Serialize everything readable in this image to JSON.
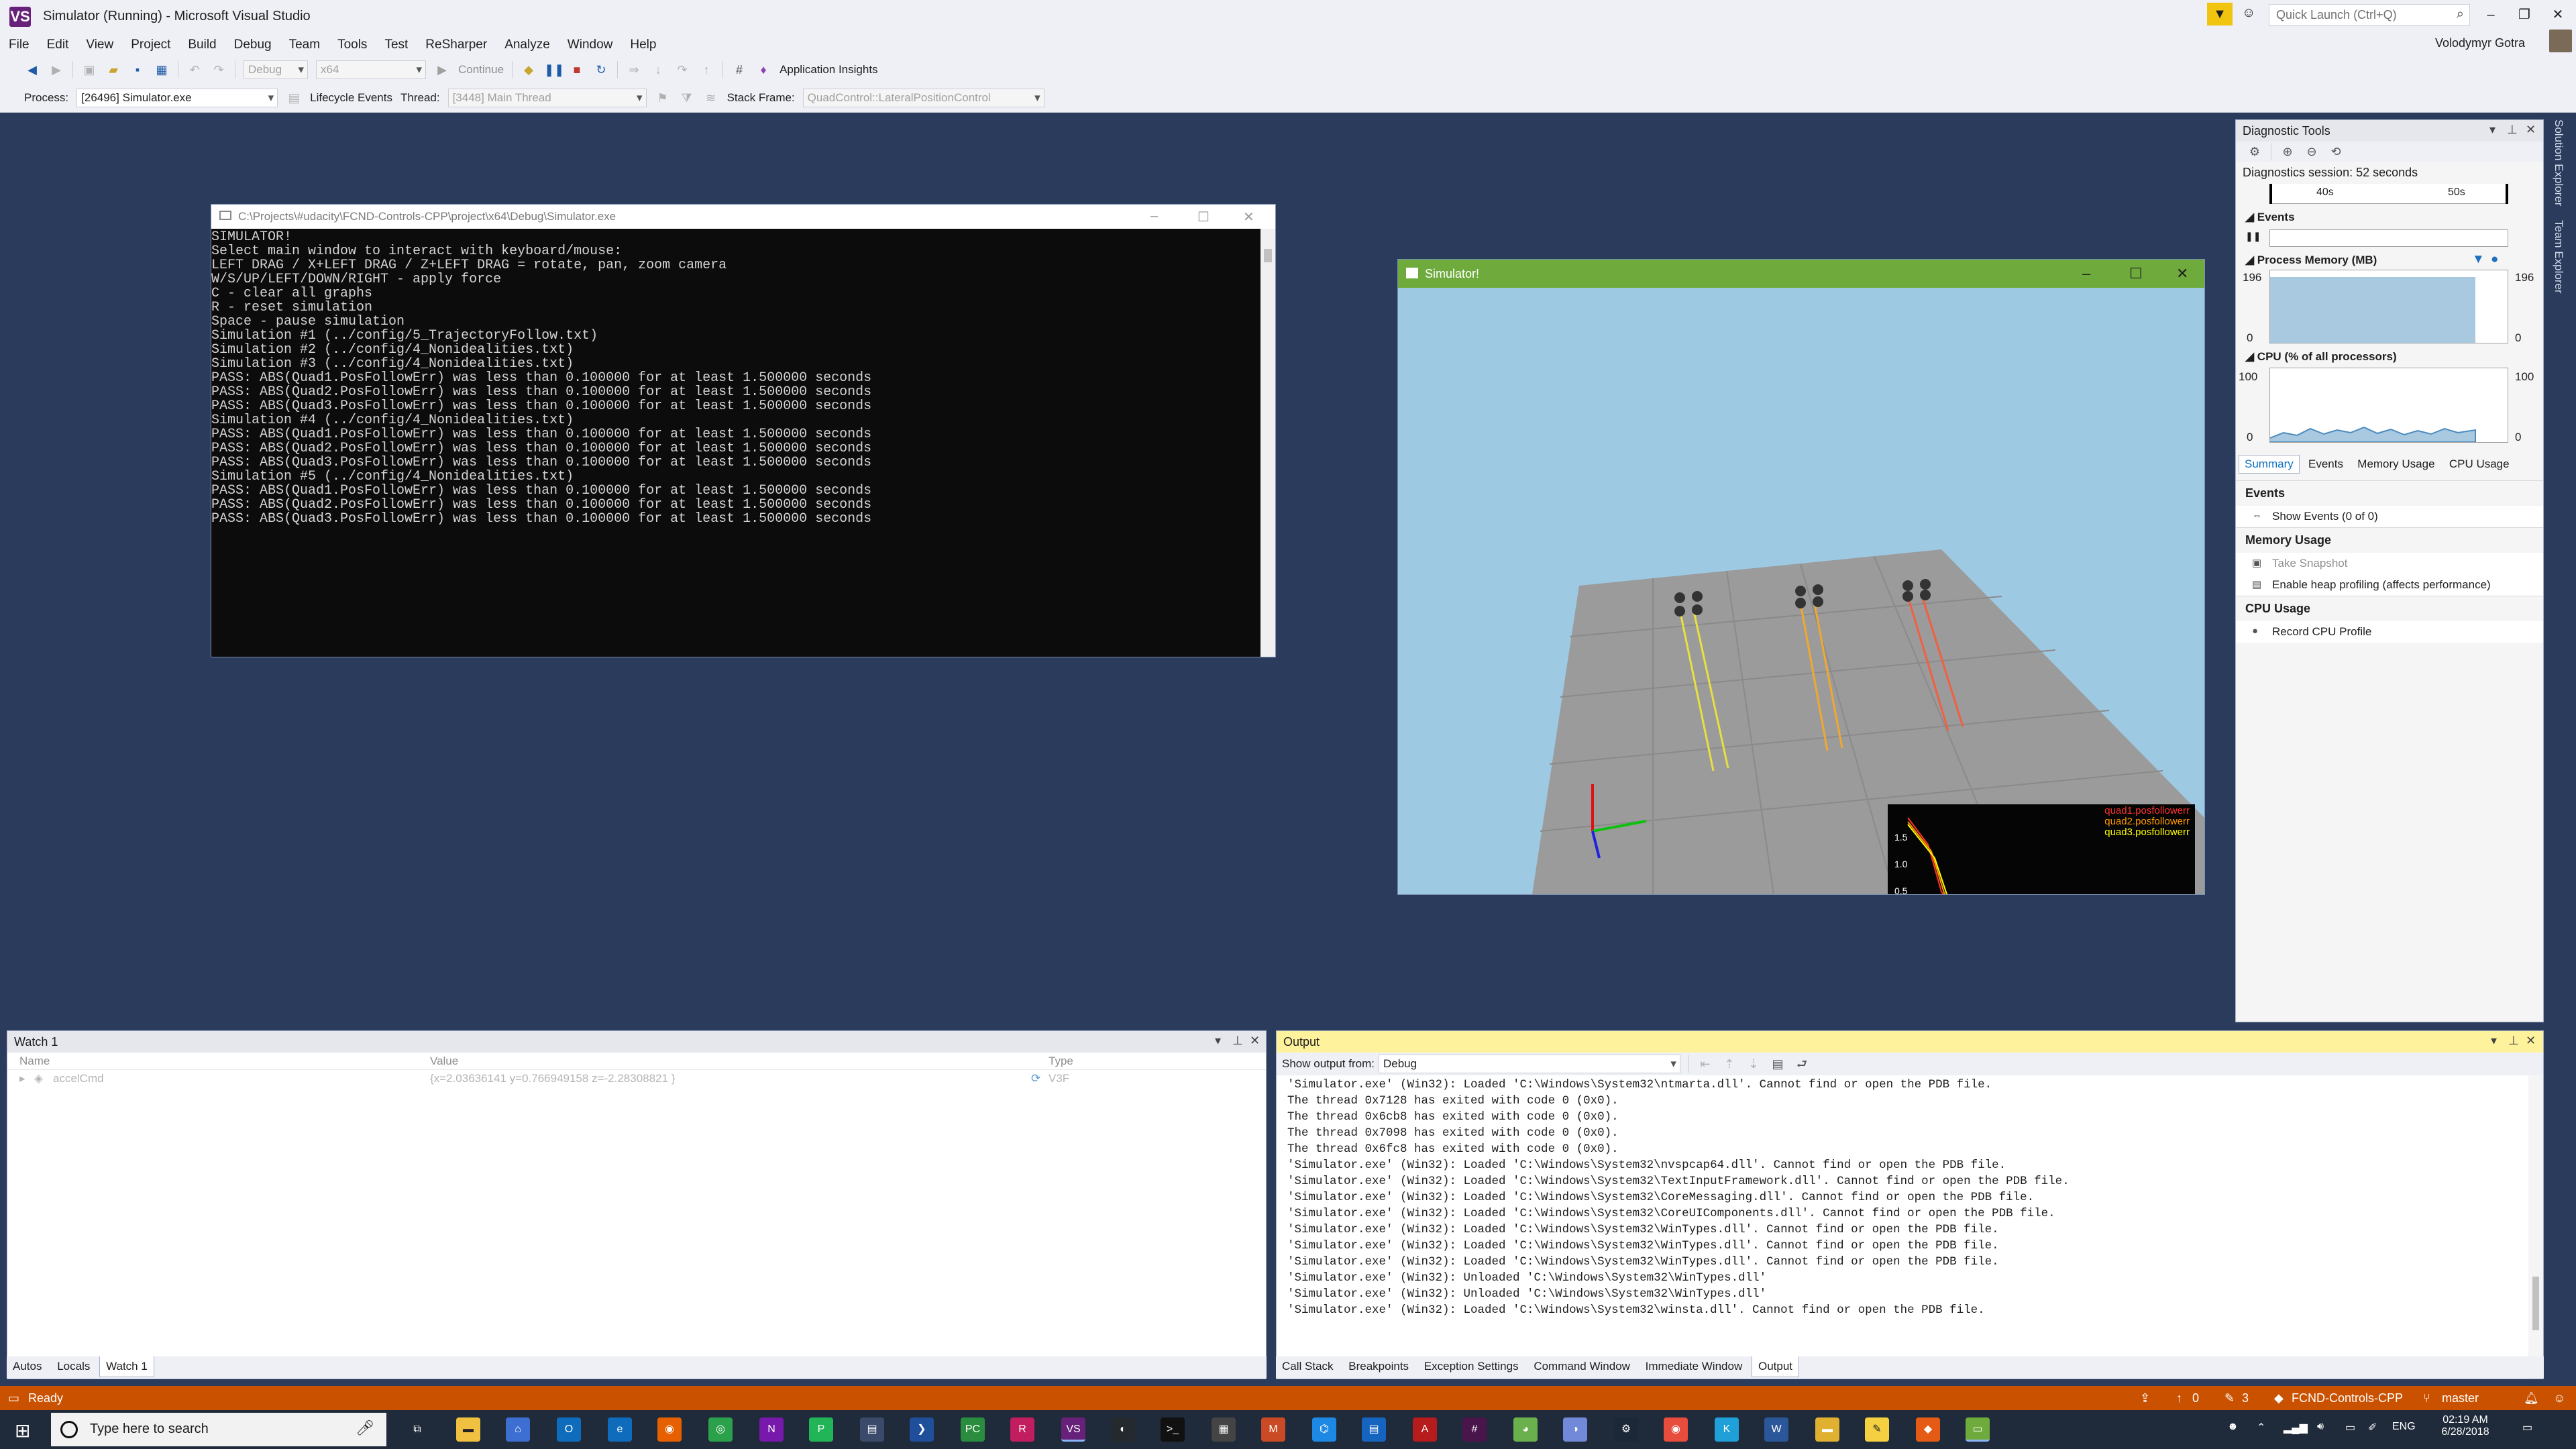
{
  "window": {
    "title": "Simulator (Running) - Microsoft Visual Studio",
    "logo": "VS"
  },
  "quick_launch": {
    "placeholder": "Quick Launch (Ctrl+Q)"
  },
  "user": {
    "name": "Volodymyr Gotra"
  },
  "menu": [
    "File",
    "Edit",
    "View",
    "Project",
    "Build",
    "Debug",
    "Team",
    "Tools",
    "Test",
    "ReSharper",
    "Analyze",
    "Window",
    "Help"
  ],
  "toolbar": {
    "config": "Debug",
    "platform": "x64",
    "continue_label": "Continue",
    "app_insights_label": "Application Insights"
  },
  "debug_toolbar": {
    "process_label": "Process:",
    "process_value": "[26496] Simulator.exe",
    "lifecycle_label": "Lifecycle Events",
    "thread_label": "Thread:",
    "thread_value": "[3448] Main Thread",
    "stackframe_label": "Stack Frame:",
    "stackframe_value": "QuadControl::LateralPositionControl"
  },
  "console": {
    "title": "C:\\Projects\\#udacity\\FCND-Controls-CPP\\project\\x64\\Debug\\Simulator.exe",
    "lines": [
      "SIMULATOR!",
      "Select main window to interact with keyboard/mouse:",
      "LEFT DRAG / X+LEFT DRAG / Z+LEFT DRAG = rotate, pan, zoom camera",
      "W/S/UP/LEFT/DOWN/RIGHT - apply force",
      "C - clear all graphs",
      "R - reset simulation",
      "Space - pause simulation",
      "Simulation #1 (../config/5_TrajectoryFollow.txt)",
      "Simulation #2 (../config/4_Nonidealities.txt)",
      "Simulation #3 (../config/4_Nonidealities.txt)",
      "PASS: ABS(Quad1.PosFollowErr) was less than 0.100000 for at least 1.500000 seconds",
      "PASS: ABS(Quad2.PosFollowErr) was less than 0.100000 for at least 1.500000 seconds",
      "PASS: ABS(Quad3.PosFollowErr) was less than 0.100000 for at least 1.500000 seconds",
      "Simulation #4 (../config/4_Nonidealities.txt)",
      "PASS: ABS(Quad1.PosFollowErr) was less than 0.100000 for at least 1.500000 seconds",
      "PASS: ABS(Quad2.PosFollowErr) was less than 0.100000 for at least 1.500000 seconds",
      "PASS: ABS(Quad3.PosFollowErr) was less than 0.100000 for at least 1.500000 seconds",
      "Simulation #5 (../config/4_Nonidealities.txt)",
      "PASS: ABS(Quad1.PosFollowErr) was less than 0.100000 for at least 1.500000 seconds",
      "PASS: ABS(Quad2.PosFollowErr) was less than 0.100000 for at least 1.500000 seconds",
      "PASS: ABS(Quad3.PosFollowErr) was less than 0.100000 for at least 1.500000 seconds"
    ]
  },
  "simulator": {
    "title": "Simulator!",
    "graph": {
      "legend": [
        "quad1.posfollowerr",
        "quad2.posfollowerr",
        "quad3.posfollowerr"
      ],
      "legend_colors": [
        "#ff3030",
        "#ff9a00",
        "#ffff00"
      ],
      "yticks": [
        "1.5",
        "1.0",
        "0.5"
      ]
    }
  },
  "diagnostic_tools": {
    "title": "Diagnostic Tools",
    "session": "Diagnostics session: 52 seconds",
    "timeline_ticks": [
      "40s",
      "50s"
    ],
    "events_label": "Events",
    "memory_label": "Process Memory (MB)",
    "memory_max": "196",
    "memory_min": "0",
    "cpu_label": "CPU (% of all processors)",
    "cpu_max": "100",
    "cpu_min": "0",
    "tabs": [
      "Summary",
      "Events",
      "Memory Usage",
      "CPU Usage"
    ],
    "sections": {
      "events": "Events",
      "show_events": "Show Events (0 of 0)",
      "memory": "Memory Usage",
      "take_snapshot": "Take Snapshot",
      "heap_profiling": "Enable heap profiling (affects performance)",
      "cpu": "CPU Usage",
      "record_cpu": "Record CPU Profile"
    }
  },
  "side_tabs": [
    "Solution Explorer",
    "Team Explorer"
  ],
  "watch": {
    "title": "Watch 1",
    "columns": [
      "Name",
      "Value",
      "Type"
    ],
    "rows": [
      {
        "name": "accelCmd",
        "value": "{x=2.03636141 y=0.766949158 z=-2.28308821 }",
        "type": "V3F"
      }
    ],
    "tabs": [
      "Autos",
      "Locals",
      "Watch 1"
    ]
  },
  "output": {
    "title": "Output",
    "show_from_label": "Show output from:",
    "show_from_value": "Debug",
    "lines": [
      "'Simulator.exe' (Win32): Loaded 'C:\\Windows\\System32\\ntmarta.dll'. Cannot find or open the PDB file.",
      "The thread 0x7128 has exited with code 0 (0x0).",
      "The thread 0x6cb8 has exited with code 0 (0x0).",
      "The thread 0x7098 has exited with code 0 (0x0).",
      "The thread 0x6fc8 has exited with code 0 (0x0).",
      "'Simulator.exe' (Win32): Loaded 'C:\\Windows\\System32\\nvspcap64.dll'. Cannot find or open the PDB file.",
      "'Simulator.exe' (Win32): Loaded 'C:\\Windows\\System32\\TextInputFramework.dll'. Cannot find or open the PDB file.",
      "'Simulator.exe' (Win32): Loaded 'C:\\Windows\\System32\\CoreMessaging.dll'. Cannot find or open the PDB file.",
      "'Simulator.exe' (Win32): Loaded 'C:\\Windows\\System32\\CoreUIComponents.dll'. Cannot find or open the PDB file.",
      "'Simulator.exe' (Win32): Loaded 'C:\\Windows\\System32\\WinTypes.dll'. Cannot find or open the PDB file.",
      "'Simulator.exe' (Win32): Loaded 'C:\\Windows\\System32\\WinTypes.dll'. Cannot find or open the PDB file.",
      "'Simulator.exe' (Win32): Loaded 'C:\\Windows\\System32\\WinTypes.dll'. Cannot find or open the PDB file.",
      "'Simulator.exe' (Win32): Unloaded 'C:\\Windows\\System32\\WinTypes.dll'",
      "'Simulator.exe' (Win32): Unloaded 'C:\\Windows\\System32\\WinTypes.dll'",
      "'Simulator.exe' (Win32): Loaded 'C:\\Windows\\System32\\winsta.dll'. Cannot find or open the PDB file."
    ],
    "tabs": [
      "Call Stack",
      "Breakpoints",
      "Exception Settings",
      "Command Window",
      "Immediate Window",
      "Output"
    ]
  },
  "status_bar": {
    "ready": "Ready",
    "up_count": "0",
    "edit_count": "3",
    "repo": "FCND-Controls-CPP",
    "branch": "master"
  },
  "taskbar": {
    "search_placeholder": "Type here to search",
    "lang": "ENG",
    "time": "02:19 AM",
    "date": "6/28/2018"
  },
  "colors": {
    "accent": "#68217a",
    "status": "#ca5100",
    "background": "#2b3b5c",
    "sim_title": "#6fab3c"
  }
}
